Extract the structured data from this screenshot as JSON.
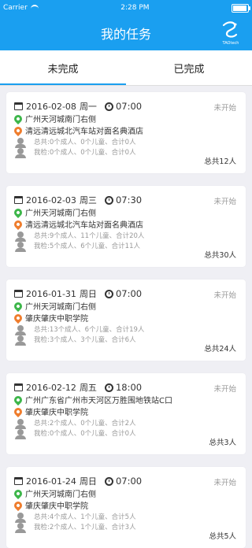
{
  "status_bar": {
    "carrier": "Carrier",
    "time": "2:28 PM"
  },
  "header": {
    "title": "我的任务",
    "logo_text": "TAOtech"
  },
  "tabs": [
    {
      "label": "未完成"
    },
    {
      "label": "已完成"
    }
  ],
  "tasks": [
    {
      "date": "2016-02-08",
      "weekday": "周一",
      "time": "07:00",
      "status": "未开始",
      "from": "广州天河城南门右侧",
      "to": "清远清远城北汽车站对面名典酒店",
      "total_line": "总共:0个成人、0个儿童、合计0人",
      "check_line": "我检:0个成人、0个儿童、合计0人",
      "total": "总共12人"
    },
    {
      "date": "2016-02-03",
      "weekday": "周三",
      "time": "07:30",
      "status": "未开始",
      "from": "广州天河城南门右侧",
      "to": "清远清远城北汽车站对面名典酒店",
      "total_line": "总共:9个成人、11个儿童、合计20人",
      "check_line": "我检:5个成人、6个儿童、合计11人",
      "total": "总共30人"
    },
    {
      "date": "2016-01-31",
      "weekday": "周日",
      "time": "07:00",
      "status": "未开始",
      "from": "广州天河城南门右侧",
      "to": "肇庆肇庆中职学院",
      "total_line": "总共:13个成人、6个儿童、合计19人",
      "check_line": "我检:3个成人、3个儿童、合计6人",
      "total": "总共24人"
    },
    {
      "date": "2016-02-12",
      "weekday": "周五",
      "time": "18:00",
      "status": "未开始",
      "from": "广州广东省广州市天河区万胜围地铁站C口",
      "to": "肇庆肇庆中职学院",
      "total_line": "总共:2个成人、0个儿童、合计2人",
      "check_line": "我检:0个成人、0个儿童、合计0人",
      "total": "总共3人"
    },
    {
      "date": "2016-01-24",
      "weekday": "周日",
      "time": "07:00",
      "status": "未开始",
      "from": "广州天河城南门右侧",
      "to": "肇庆肇庆中职学院",
      "total_line": "总共:4个成人、1个儿童、合计5人",
      "check_line": "我检:2个成人、1个儿童、合计3人",
      "total": "总共5人"
    }
  ]
}
